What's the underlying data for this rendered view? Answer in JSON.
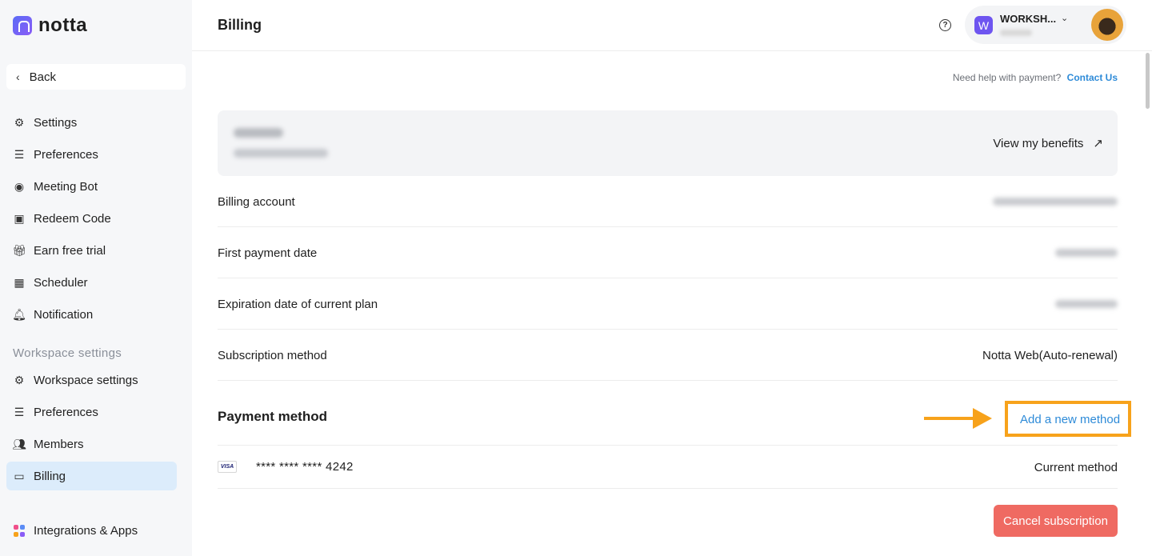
{
  "app": {
    "logo_text": "notta"
  },
  "sidebar": {
    "back_label": "Back",
    "items": [
      {
        "label": "Settings",
        "icon": "gear-icon"
      },
      {
        "label": "Preferences",
        "icon": "sliders-icon"
      },
      {
        "label": "Meeting Bot",
        "icon": "bot-icon"
      },
      {
        "label": "Redeem Code",
        "icon": "redeem-icon"
      },
      {
        "label": "Earn free trial",
        "icon": "gift-icon"
      },
      {
        "label": "Scheduler",
        "icon": "calendar-icon"
      },
      {
        "label": "Notification",
        "icon": "bell-icon"
      }
    ],
    "workspace_section_title": "Workspace settings",
    "workspace_items": [
      {
        "label": "Workspace settings",
        "icon": "gear-icon"
      },
      {
        "label": "Preferences",
        "icon": "sliders-icon"
      },
      {
        "label": "Members",
        "icon": "members-icon"
      },
      {
        "label": "Billing",
        "icon": "card-icon",
        "active": true
      }
    ],
    "integrations_label": "Integrations & Apps"
  },
  "header": {
    "title": "Billing",
    "workspace_initial": "W",
    "workspace_name": "WORKSH..."
  },
  "main": {
    "help_text": "Need help with payment?",
    "contact_link": "Contact Us",
    "plan_card": {
      "benefits_label": "View my benefits"
    },
    "rows": [
      {
        "label": "Billing account"
      },
      {
        "label": "First payment date"
      },
      {
        "label": "Expiration date of current plan"
      },
      {
        "label": "Subscription method",
        "value": "Notta Web(Auto-renewal)"
      }
    ],
    "payment": {
      "title": "Payment method",
      "add_label": "Add a new method",
      "card_brand": "VISA",
      "card_number": "**** **** **** 4242",
      "card_status": "Current method"
    },
    "cancel_label": "Cancel subscription"
  },
  "colors": {
    "accent": "#2e8bd8",
    "active_bg": "#dcecfb",
    "danger": "#ef6a62",
    "annotation": "#f7a21b",
    "workspace_avatar": "#6e55f0"
  }
}
